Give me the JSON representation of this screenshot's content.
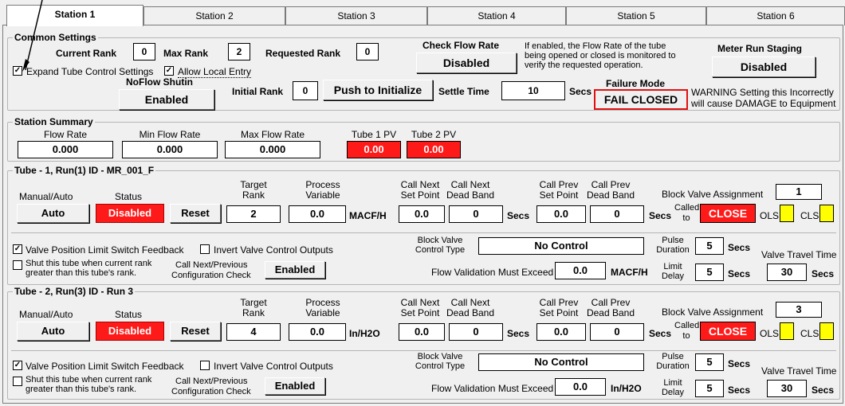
{
  "tabs": [
    "Station 1",
    "Station 2",
    "Station 3",
    "Station 4",
    "Station 5",
    "Station 6"
  ],
  "common": {
    "title": "Common Settings",
    "current_rank_label": "Current Rank",
    "current_rank": "0",
    "max_rank_label": "Max Rank",
    "max_rank": "2",
    "requested_rank_label": "Requested Rank",
    "requested_rank": "0",
    "check_flow_label": "Check Flow Rate",
    "check_flow_value": "Disabled",
    "check_flow_note_1": "If enabled, the Flow Rate of the tube",
    "check_flow_note_2": "being opened or closed is monitored to",
    "check_flow_note_3": "verify the requested operation.",
    "meter_run_label": "Meter Run Staging",
    "meter_run_value": "Disabled",
    "expand_label": "Expand Tube Control Settings",
    "allow_local_label": "Allow Local Entry",
    "noflow_label": "NoFlow Shutin",
    "noflow_value": "Enabled",
    "initial_rank_label": "Initial Rank",
    "initial_rank": "0",
    "push_init_label": "Push to Initialize",
    "settle_label": "Settle Time",
    "settle_value": "10",
    "secs": "Secs",
    "failure_label": "Failure Mode",
    "failure_value": "FAIL CLOSED",
    "warning_1": "WARNING Setting  this Incorrectly",
    "warning_2": "will cause DAMAGE to Equipment"
  },
  "summary": {
    "title": "Station Summary",
    "flow_rate_label": "Flow Rate",
    "flow_rate": "0.000",
    "min_flow_label": "Min Flow Rate",
    "min_flow": "0.000",
    "max_flow_label": "Max Flow Rate",
    "max_flow": "0.000",
    "tube1_pv_label": "Tube 1 PV",
    "tube1_pv": "0.00",
    "tube2_pv_label": "Tube 2 PV",
    "tube2_pv": "0.00"
  },
  "headers": {
    "manual_auto": "Manual/Auto",
    "status": "Status",
    "target_1": "Target",
    "target_2": "Rank",
    "process_1": "Process",
    "process_2": "Variable",
    "cn_sp_1": "Call Next",
    "cn_sp_2": "Set Point",
    "cn_db_1": "Call Next",
    "cn_db_2": "Dead Band",
    "cp_sp_1": "Call Prev",
    "cp_sp_2": "Set Point",
    "cp_db_1": "Call Prev",
    "cp_db_2": "Dead Band",
    "block_valve_assign": "Block Valve Assignment",
    "called_1": "Called",
    "called_2": "to",
    "ols": "OLS",
    "cls": "CLS",
    "vplsf": "Valve Position Limit Switch Feedback",
    "invert": "Invert Valve Control Outputs",
    "shut_1": "Shut this tube when current rank",
    "shut_2": "greater than this tube's rank.",
    "cnp_1": "Call Next/Previous",
    "cnp_2": "Configuration Check",
    "bvct_1": "Block Valve",
    "bvct_2": "Control Type",
    "pulse_1": "Pulse",
    "pulse_2": "Duration",
    "valve_travel": "Valve Travel Time",
    "flow_validation": "Flow Validation Must Exceed",
    "limit_1": "Limit",
    "limit_2": "Delay",
    "secs": "Secs"
  },
  "tubes": [
    {
      "title": "Tube - 1, Run(1) ID - MR_001_F",
      "auto": "Auto",
      "status": "Disabled",
      "reset": "Reset",
      "target_rank": "2",
      "process_variable": "0.0",
      "pv_unit": "MACF/H",
      "cn_sp": "0.0",
      "cn_db": "0",
      "cp_sp": "0.0",
      "cp_db": "0",
      "block_valve": "1",
      "called": "CLOSE",
      "cnp_value": "Enabled",
      "control_type": "No Control",
      "pulse": "5",
      "flow_val": "0.0",
      "flow_unit": "MACF/H",
      "limit": "5",
      "travel": "30"
    },
    {
      "title": "Tube - 2, Run(3) ID - Run 3",
      "auto": "Auto",
      "status": "Disabled",
      "reset": "Reset",
      "target_rank": "4",
      "process_variable": "0.0",
      "pv_unit": "In/H2O",
      "cn_sp": "0.0",
      "cn_db": "0",
      "cp_sp": "0.0",
      "cp_db": "0",
      "block_valve": "3",
      "called": "CLOSE",
      "cnp_value": "Enabled",
      "control_type": "No Control",
      "pulse": "5",
      "flow_val": "0.0",
      "flow_unit": "In/H2O",
      "limit": "5",
      "travel": "30"
    }
  ],
  "colors": {
    "alarm_red": "#ff1a1a",
    "indicator_yellow": "#ffff00",
    "warning_border": "#e01010"
  }
}
